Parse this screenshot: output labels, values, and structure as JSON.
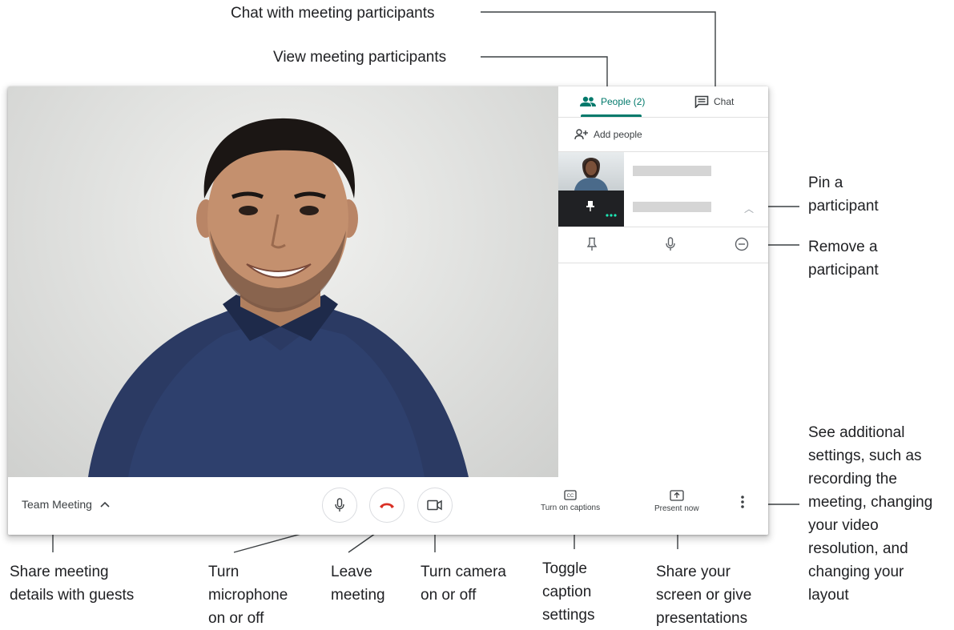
{
  "annotations": {
    "chat": "Chat with meeting participants",
    "view": "View meeting participants",
    "pin": [
      "Pin a",
      "participant"
    ],
    "remove": [
      "Remove a",
      "participant"
    ],
    "settings": [
      "See additional",
      "settings, such as",
      "recording the",
      "meeting, changing",
      "your video",
      "resolution, and",
      "changing your",
      "layout"
    ],
    "share_details": [
      "Share meeting",
      "details with guests"
    ],
    "mic": [
      "Turn",
      "microphone",
      "on or off"
    ],
    "leave": [
      "Leave",
      "meeting"
    ],
    "camera": [
      "Turn camera",
      "on or off"
    ],
    "captions": [
      "Toggle",
      "caption",
      "settings"
    ],
    "present": [
      "Share your",
      "screen or give",
      "presentations"
    ]
  },
  "panel": {
    "tab_people": "People (2)",
    "tab_chat": "Chat",
    "add_people": "Add people"
  },
  "bottombar": {
    "meeting_name": "Team Meeting",
    "captions_label": "Turn on captions",
    "present_label": "Present now"
  },
  "colors": {
    "accent": "#00796b",
    "hangup": "#d93025",
    "dots": "#1de9b6"
  },
  "icons": [
    "people-icon",
    "chat-icon",
    "add-person-icon",
    "pin-icon",
    "microphone-icon",
    "remove-icon",
    "chevron-up-icon",
    "hangup-icon",
    "camera-icon",
    "captions-icon",
    "present-icon",
    "more-vert-icon"
  ]
}
